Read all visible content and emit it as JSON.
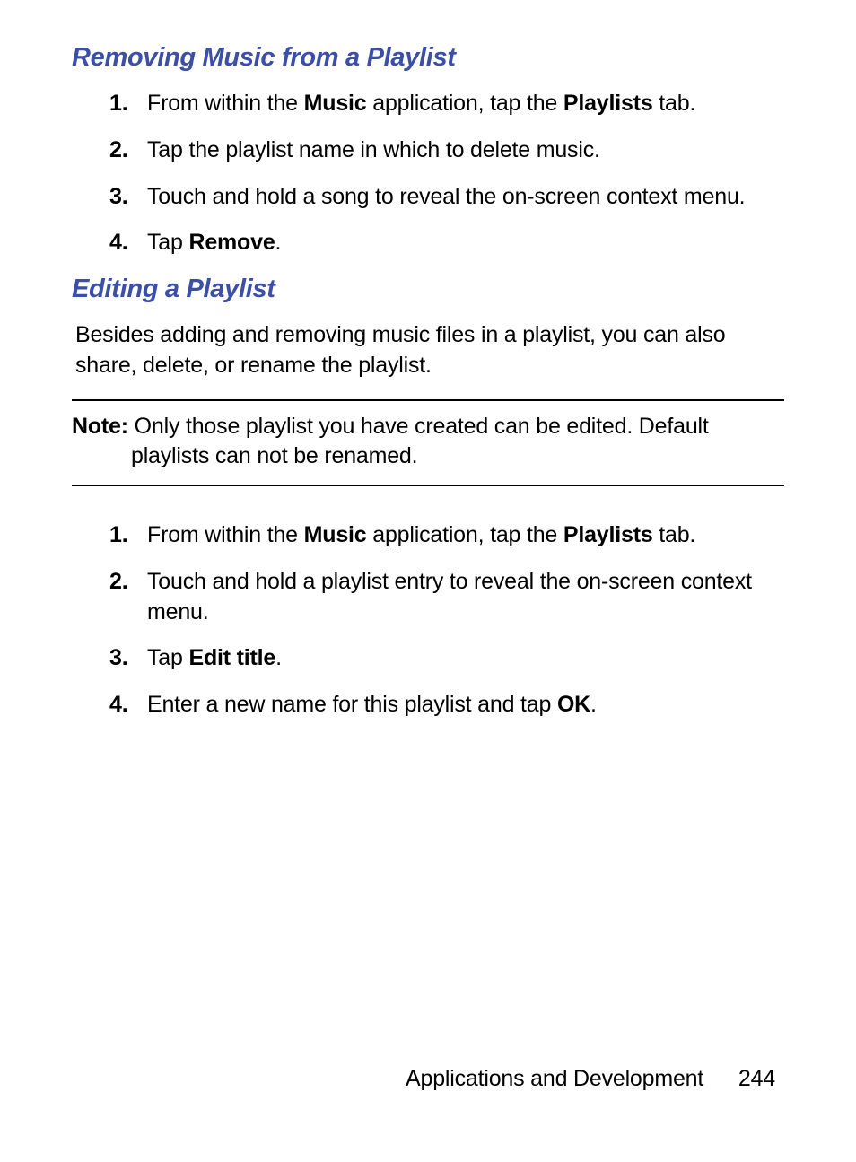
{
  "section1": {
    "heading": "Removing Music from a Playlist",
    "items": [
      {
        "num": "1.",
        "pre": "From within the ",
        "b1": "Music",
        "mid": " application, tap the ",
        "b2": "Playlists",
        "post": " tab."
      },
      {
        "num": "2.",
        "text": "Tap the playlist name in which to delete music."
      },
      {
        "num": "3.",
        "text": "Touch and hold a song to reveal the on-screen context menu."
      },
      {
        "num": "4.",
        "pre": "Tap ",
        "b1": "Remove",
        "post": "."
      }
    ]
  },
  "section2": {
    "heading": "Editing a Playlist",
    "intro": "Besides adding and removing music files in a playlist, you can also share, delete, or rename the playlist.",
    "note_label": "Note:",
    "note_text_line1": " Only those playlist you have created can be edited. Default",
    "note_text_line2": "playlists can not be renamed.",
    "items": [
      {
        "num": "1.",
        "pre": "From within the ",
        "b1": "Music",
        "mid": " application, tap the ",
        "b2": "Playlists",
        "post": " tab."
      },
      {
        "num": "2.",
        "text": "Touch and hold a playlist entry to reveal the on-screen context menu."
      },
      {
        "num": "3.",
        "pre": "Tap ",
        "b1": "Edit title",
        "post": "."
      },
      {
        "num": "4.",
        "pre": "Enter a new name for this playlist and tap ",
        "b1": "OK",
        "post": "."
      }
    ]
  },
  "footer": {
    "chapter": "Applications and Development",
    "page": "244"
  }
}
